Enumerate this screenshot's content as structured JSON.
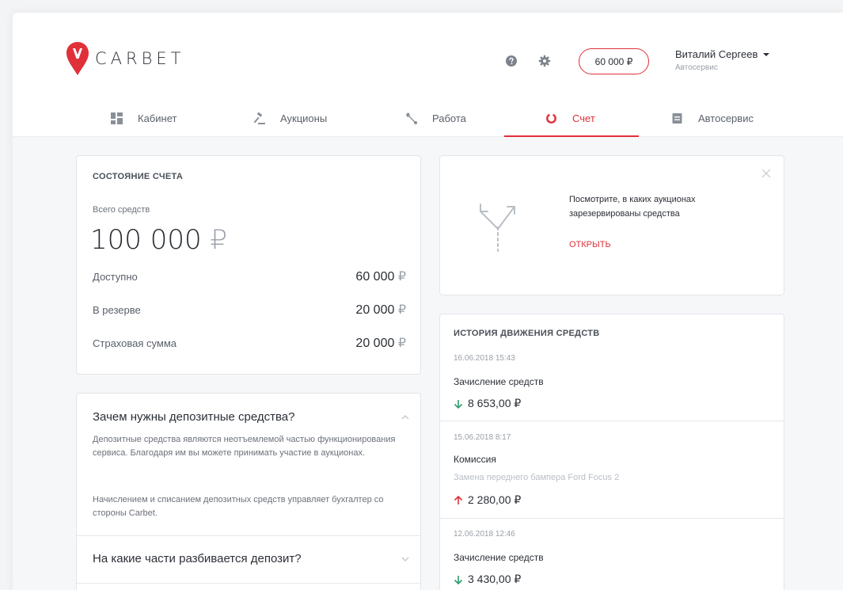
{
  "header": {
    "brand": "CARBET",
    "balance": "60 000 ₽",
    "user_name": "Виталий Сергеев",
    "user_role": "Автосервис"
  },
  "nav": {
    "items": [
      {
        "label": "Кабинет",
        "icon": "dashboard-icon"
      },
      {
        "label": "Аукционы",
        "icon": "gavel-icon"
      },
      {
        "label": "Работа",
        "icon": "wrench-icon"
      },
      {
        "label": "Счет",
        "icon": "ring-icon",
        "active": true
      },
      {
        "label": "Автосервис",
        "icon": "document-icon"
      }
    ]
  },
  "account": {
    "title": "СОСТОЯНИЕ СЧЕТА",
    "total_label": "Всего средств",
    "total_amount": "100 000",
    "currency": "₽",
    "rows": [
      {
        "label": "Доступно",
        "amount": "60 000"
      },
      {
        "label": "В резерве",
        "amount": "20 000"
      },
      {
        "label": "Страховая сумма",
        "amount": "20 000"
      }
    ]
  },
  "promo": {
    "text": "Посмотрите, в каких аукционах зарезервированы средства",
    "link": "ОТКРЫТЬ"
  },
  "faq": {
    "items": [
      {
        "question": "Зачем нужны депозитные средства?",
        "answer_1": "Депозитные средства являются неотъемлемой частью функционирования сервиса. Благодаря им вы можете принимать участие в аукционах.",
        "answer_2": "Начислением и списанием депозитных средств управляет бухгалтер со стороны Carbet.",
        "expanded": true
      },
      {
        "question": "На какие части разбивается депозит?",
        "expanded": false
      }
    ]
  },
  "history": {
    "title": "ИСТОРИЯ ДВИЖЕНИЯ СРЕДСТВ",
    "items": [
      {
        "date": "16.06.2018 15:43",
        "title": "Зачисление средств",
        "subtitle": "",
        "amount": "8 653,00 ₽",
        "direction": "in"
      },
      {
        "date": "15.06.2018 8:17",
        "title": "Комиссия",
        "subtitle": "Замена переднего бампера Ford Focus 2",
        "amount": "2 280,00 ₽",
        "direction": "out"
      },
      {
        "date": "12.06.2018 12:46",
        "title": "Зачисление средств",
        "subtitle": "",
        "amount": "3 430,00 ₽",
        "direction": "in"
      }
    ]
  },
  "colors": {
    "accent": "#e0303a",
    "income": "#2e9e6b",
    "outcome": "#e0303a"
  }
}
